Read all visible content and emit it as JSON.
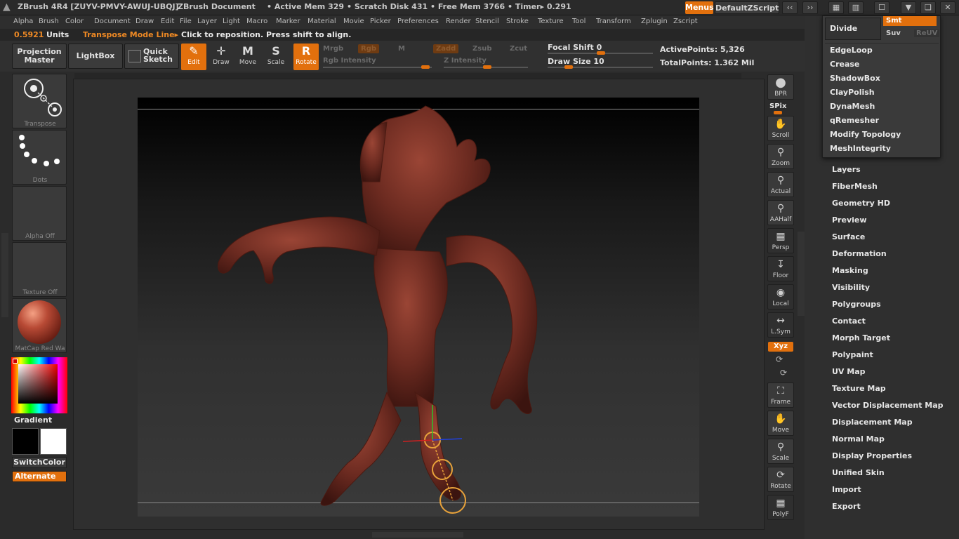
{
  "titlebar": {
    "app_title": "ZBrush 4R4 [ZUYV-PMVY-AWUJ-UBQJ]",
    "document": "ZBrush Document",
    "active_mem": "• Active Mem 329",
    "scratch_disk": "• Scratch Disk 431",
    "free_mem": "• Free Mem 3766",
    "timer": "• Timer▸ 0.291",
    "menus_label": "Menus",
    "zscript_label": "DefaultZScript"
  },
  "menubar": [
    "Alpha",
    "Brush",
    "Color",
    "Document",
    "Draw",
    "Edit",
    "File",
    "Layer",
    "Light",
    "Macro",
    "Marker",
    "Material",
    "Movie",
    "Picker",
    "Preferences",
    "Render",
    "Stencil",
    "Stroke",
    "Texture",
    "Tool",
    "Transform",
    "Zplugin",
    "Zscript"
  ],
  "infobar": {
    "units_value": "0.5921",
    "units_label": "Units",
    "mode": "Transpose Mode Line▸",
    "hint": "Click to reposition. Press shift to align."
  },
  "toolbar": {
    "projection_master": "Projection Master",
    "lightbox": "LightBox",
    "quick_sketch": "Quick Sketch",
    "edit": "Edit",
    "draw": "Draw",
    "move": "Move",
    "scale": "Scale",
    "rotate": "Rotate",
    "mrgb": "Mrgb",
    "rgb": "Rgb",
    "m": "M",
    "zadd": "Zadd",
    "zsub": "Zsub",
    "zcut": "Zcut",
    "rgb_intensity": "Rgb Intensity",
    "z_intensity": "Z Intensity",
    "focal_shift": "Focal Shift 0",
    "draw_size": "Draw Size 10",
    "active_points": "ActivePoints: 5,326",
    "total_points": "TotalPoints: 1.362 Mil"
  },
  "leftpanel": {
    "transpose": "Transpose",
    "dots": "Dots",
    "alpha_off": "Alpha Off",
    "texture_off": "Texture Off",
    "material": "MatCap Red Wa",
    "gradient": "Gradient",
    "switch_color": "SwitchColor",
    "alternate": "Alternate"
  },
  "rightshelf": {
    "bpr": "BPR",
    "spix": "SPix",
    "scroll": "Scroll",
    "zoom": "Zoom",
    "actual": "Actual",
    "aahalf": "AAHalf",
    "persp": "Persp",
    "floor": "Floor",
    "local": "Local",
    "lsym": "L.Sym",
    "xyz": "Xyz",
    "frame": "Frame",
    "move": "Move",
    "scale": "Scale",
    "rotate": "Rotate",
    "polyf": "PolyF"
  },
  "dropdown": {
    "divide": "Divide",
    "smt": "Smt",
    "suv": "Suv",
    "reuv": "ReUV",
    "items": [
      "EdgeLoop",
      "Crease",
      "ShadowBox",
      "ClayPolish",
      "DynaMesh",
      "qRemesher",
      "Modify Topology",
      "MeshIntegrity"
    ]
  },
  "rightpanel": {
    "items": [
      "Layers",
      "FiberMesh",
      "Geometry HD",
      "Preview",
      "Surface",
      "Deformation",
      "Masking",
      "Visibility",
      "Polygroups",
      "Contact",
      "Morph Target",
      "Polypaint",
      "UV Map",
      "Texture Map",
      "Vector Displacement Map",
      "Displacement Map",
      "Normal Map",
      "Display Properties",
      "Unified Skin",
      "Import",
      "Export"
    ]
  },
  "colors": {
    "accent": "#e2700d",
    "model": "#6e2a22"
  }
}
